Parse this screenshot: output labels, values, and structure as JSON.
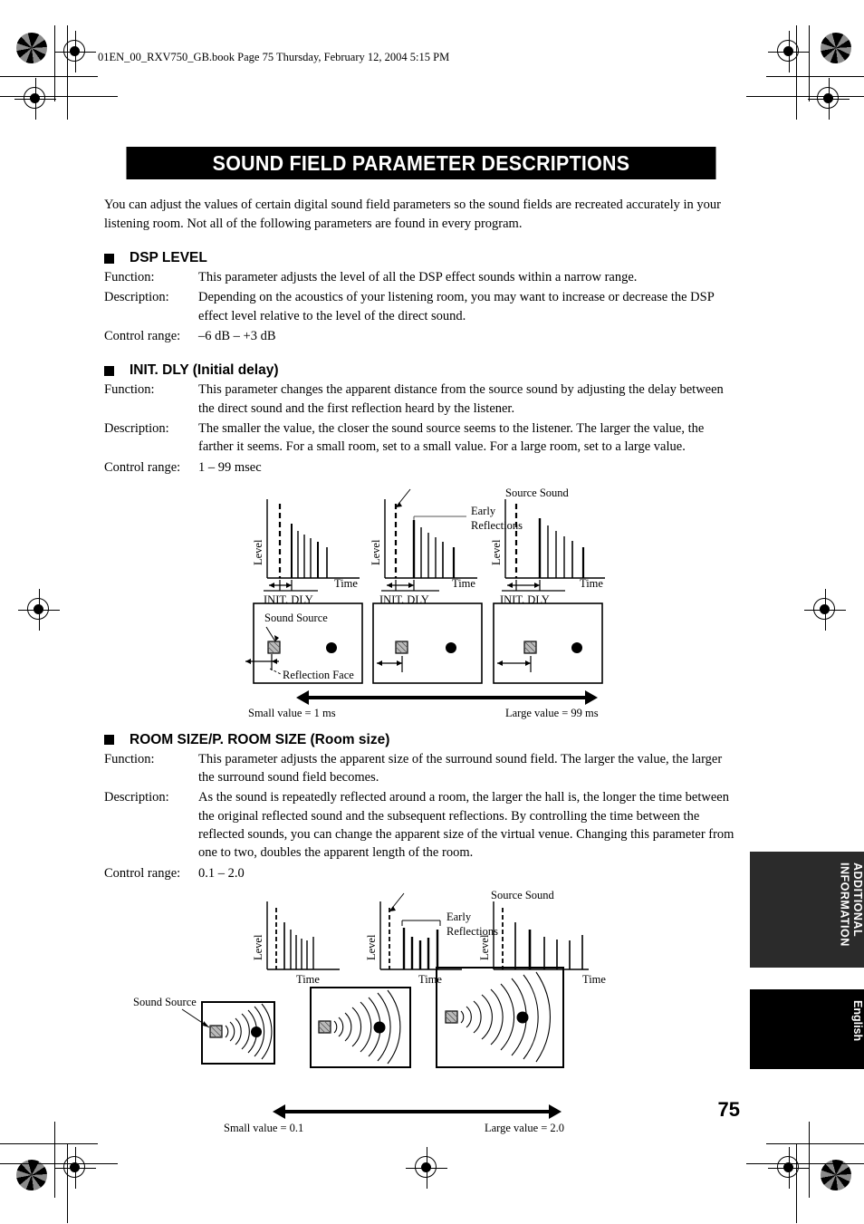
{
  "print_marks": {
    "header_line": "01EN_00_RXV750_GB.book  Page 75  Thursday, February 12, 2004  5:15 PM"
  },
  "title": "SOUND FIELD PARAMETER DESCRIPTIONS",
  "intro": "You can adjust the values of certain digital sound field parameters so the sound fields are recreated accurately in your listening room. Not all of the following parameters are found in every program.",
  "labels": {
    "function": "Function:",
    "description": "Description:",
    "control_range": "Control range:"
  },
  "sections": [
    {
      "heading": "DSP LEVEL",
      "function": "This parameter adjusts the level of all the DSP effect sounds within a narrow range.",
      "description": "Depending on the acoustics of your listening room, you may want to increase or decrease the DSP effect level relative to the level of the direct sound.",
      "control_range": "–6 dB – +3 dB"
    },
    {
      "heading": "INIT. DLY (Initial delay)",
      "function": "This parameter changes the apparent distance from the source sound by adjusting the delay between the direct sound and the first reflection heard by the listener.",
      "description": "The smaller the value, the closer the sound source seems to the listener. The larger the value, the farther it seems. For a small room, set to a small value. For a large room, set to a large value.",
      "control_range": "1 – 99 msec"
    },
    {
      "heading": "ROOM SIZE/P. ROOM SIZE (Room size)",
      "function": "This parameter adjusts the apparent size of the surround sound field. The larger the value, the larger the surround sound field becomes.",
      "description": "As the sound is repeatedly reflected around a room, the larger the hall is, the longer the time between the original reflected sound and the subsequent reflections. By controlling the time between the reflected sounds, you can change the apparent size of the virtual venue. Changing this parameter from one to two, doubles the apparent length of the room.",
      "control_range": "0.1 – 2.0"
    }
  ],
  "figure_init_dly": {
    "axis_level": "Level",
    "axis_time": "Time",
    "init_dly_label": "INIT. DLY",
    "source_sound": "Source Sound",
    "early_reflections_line1": "Early",
    "early_reflections_line2": "Reflections",
    "sound_source": "Sound Source",
    "reflection_face": "Reflection Face",
    "small_value": "Small value = 1 ms",
    "large_value": "Large value = 99 ms"
  },
  "figure_room_size": {
    "axis_level": "Level",
    "axis_time": "Time",
    "source_sound": "Source Sound",
    "early_reflections_line1": "Early",
    "early_reflections_line2": "Reflections",
    "sound_source": "Sound Source",
    "small_value": "Small value = 0.1",
    "large_value": "Large value = 2.0"
  },
  "side_tabs": {
    "additional_information": "ADDITIONAL\nINFORMATION",
    "language": "English"
  },
  "page_number": "75"
}
